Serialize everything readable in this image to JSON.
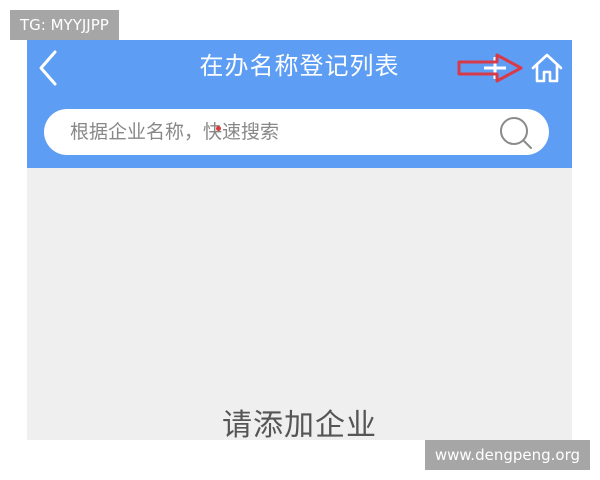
{
  "watermarks": {
    "top_left": "TG: MYYJJPP",
    "bottom_right": "www.dengpeng.org"
  },
  "navbar": {
    "title": "在办名称登记列表",
    "back_icon": "chevron-left-icon",
    "add_icon": "plus-icon",
    "home_icon": "home-icon",
    "background_color": "#5d9ef4",
    "annotation_arrow_color": "#d93a4a"
  },
  "search": {
    "placeholder": "根据企业名称，快速搜索",
    "value": "",
    "icon": "search-icon"
  },
  "content": {
    "empty_hint": "请添加企业"
  }
}
